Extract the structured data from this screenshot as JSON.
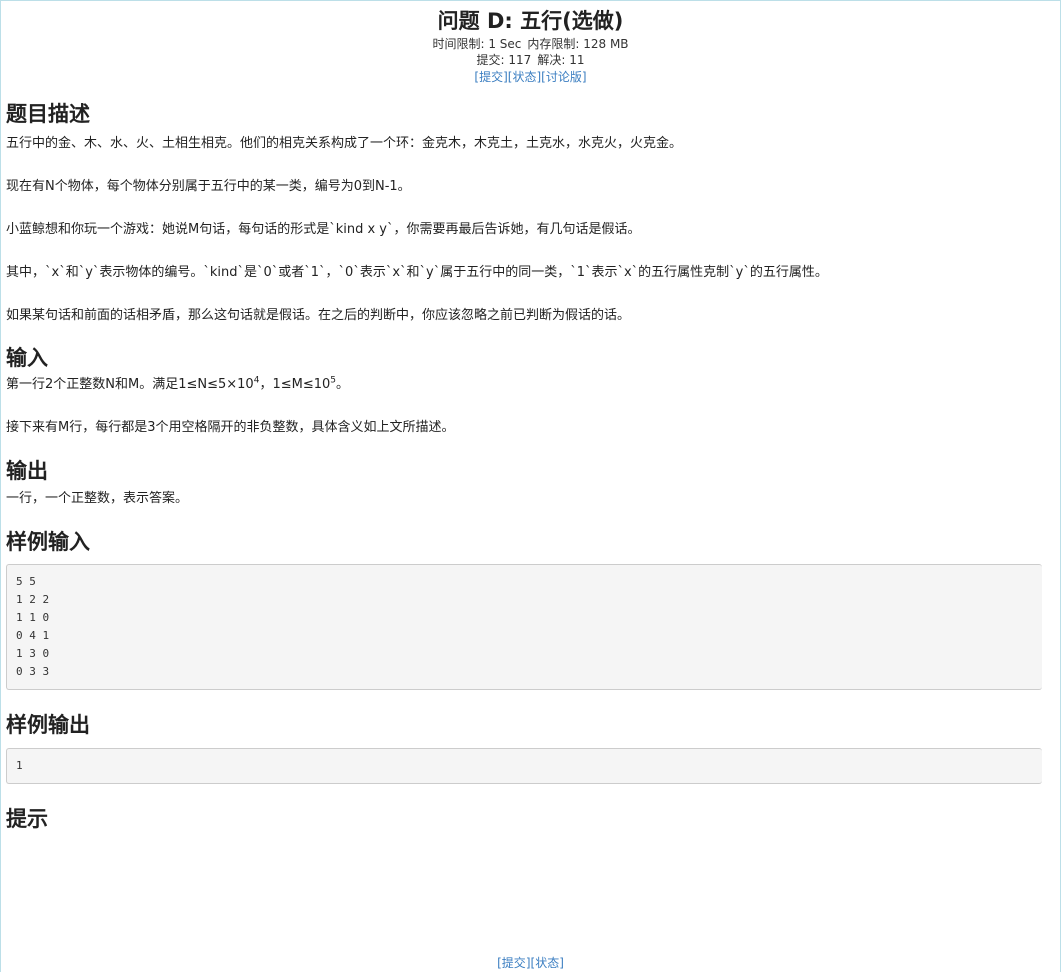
{
  "problem": {
    "title": "问题 D: 五行(选做)",
    "time_limit_label": "时间限制:",
    "time_limit": "1 Sec",
    "memory_limit_label": "内存限制:",
    "memory_limit": "128 MB",
    "submit_label": "提交:",
    "submit_count": "117",
    "solved_label": "解决:",
    "solved_count": "11"
  },
  "top_links": {
    "submit": "提交",
    "status": "状态",
    "discuss": "讨论版"
  },
  "sections": {
    "description": {
      "heading": "题目描述",
      "paragraphs": [
        "五行中的金、木、水、火、土相生相克。他们的相克关系构成了一个环：金克木，木克土，土克水，水克火，火克金。",
        "现在有N个物体，每个物体分别属于五行中的某一类，编号为0到N-1。",
        "小蓝鲸想和你玩一个游戏：她说M句话，每句话的形式是`kind x y`，你需要再最后告诉她，有几句话是假话。",
        "其中，`x`和`y`表示物体的编号。`kind`是`0`或者`1`，`0`表示`x`和`y`属于五行中的同一类，`1`表示`x`的五行属性克制`y`的五行属性。",
        "如果某句话和前面的话相矛盾，那么这句话就是假话。在之后的判断中，你应该忽略之前已判断为假话的话。"
      ]
    },
    "input": {
      "heading": "输入",
      "line1_prefix": "第一行2个正整数N和M。满足1≤N≤5×10",
      "line1_exp1": "4",
      "line1_mid": "，1≤M≤10",
      "line1_exp2": "5",
      "line1_suffix": "。",
      "line2": "接下来有M行，每行都是3个用空格隔开的非负整数，具体含义如上文所描述。"
    },
    "output": {
      "heading": "输出",
      "text": "一行，一个正整数，表示答案。"
    },
    "sample_input": {
      "heading": "样例输入",
      "code": "5 5\n1 2 2\n1 1 0\n0 4 1\n1 3 0\n0 3 3"
    },
    "sample_output": {
      "heading": "样例输出",
      "code": "1"
    },
    "hint": {
      "heading": "提示"
    }
  },
  "bottom_links": {
    "submit": "提交",
    "status": "状态"
  },
  "colors": {
    "link": "#3b7ec1",
    "code_bg": "#f5f5f5",
    "frame_border": "#bcdfe8"
  }
}
